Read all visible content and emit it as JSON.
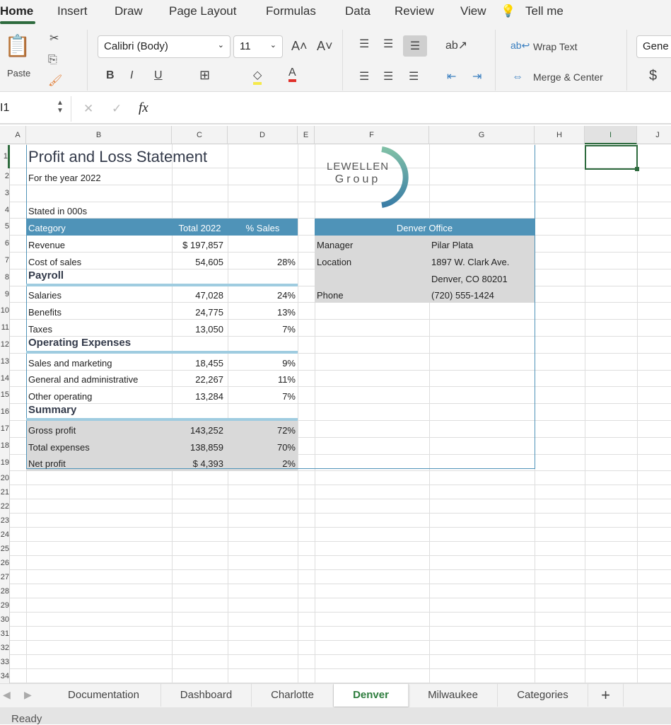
{
  "ribbon_tabs": [
    "Home",
    "Insert",
    "Draw",
    "Page Layout",
    "Formulas",
    "Data",
    "Review",
    "View",
    "Tell me"
  ],
  "ribbon": {
    "paste": "Paste",
    "font": "Calibri (Body)",
    "size": "11",
    "wrap": "Wrap Text",
    "merge": "Merge & Center",
    "number_format": "Gene",
    "bold": "B",
    "italic": "I",
    "underline": "U",
    "dollar": "$"
  },
  "formula_bar": {
    "name_box": "I1",
    "fx": "fx",
    "value": ""
  },
  "columns": [
    "A",
    "B",
    "C",
    "D",
    "E",
    "F",
    "G",
    "H",
    "I",
    "J"
  ],
  "rows": [
    "1",
    "2",
    "3",
    "4",
    "5",
    "6",
    "7",
    "8",
    "9",
    "10",
    "11",
    "12",
    "13",
    "14",
    "15",
    "16",
    "17",
    "18",
    "19",
    "20",
    "21",
    "22",
    "23",
    "24",
    "25",
    "26",
    "27",
    "28",
    "29",
    "30",
    "31",
    "32",
    "33",
    "34"
  ],
  "sheet": {
    "title": "Profit and Loss Statement",
    "subtitle": "For the year 2022",
    "stated": "Stated in 000s",
    "headers": [
      "Category",
      "Total 2022",
      "% Sales"
    ],
    "lines": [
      {
        "row": 6,
        "label": "Revenue",
        "total": "$ 197,857",
        "pct": ""
      },
      {
        "row": 7,
        "label": "Cost of sales",
        "total": "54,605",
        "pct": "28%"
      },
      {
        "row": 9,
        "label": "Salaries",
        "total": "47,028",
        "pct": "24%"
      },
      {
        "row": 10,
        "label": "Benefits",
        "total": "24,775",
        "pct": "13%"
      },
      {
        "row": 11,
        "label": "Taxes",
        "total": "13,050",
        "pct": "7%"
      },
      {
        "row": 13,
        "label": "Sales and marketing",
        "total": "18,455",
        "pct": "9%"
      },
      {
        "row": 14,
        "label": "General and administrative",
        "total": "22,267",
        "pct": "11%"
      },
      {
        "row": 15,
        "label": "Other operating",
        "total": "13,284",
        "pct": "7%"
      },
      {
        "row": 17,
        "label": "Gross profit",
        "total": "143,252",
        "pct": "72%"
      },
      {
        "row": 18,
        "label": "Total expenses",
        "total": "138,859",
        "pct": "70%"
      },
      {
        "row": 19,
        "label": "Net profit",
        "total": "$      4,393",
        "pct": "2%"
      }
    ],
    "sections": [
      {
        "row": 8,
        "label": "Payroll"
      },
      {
        "row": 12,
        "label": "Operating Expenses"
      },
      {
        "row": 16,
        "label": "Summary"
      }
    ],
    "logo": {
      "line1": "LEWELLEN",
      "line2": "Group"
    },
    "office": {
      "title": "Denver Office",
      "manager_label": "Manager",
      "manager": "Pilar Plata",
      "location_label": "Location",
      "address1": "1897 W. Clark Ave.",
      "address2": "Denver, CO 80201",
      "phone_label": "Phone",
      "phone": "(720) 555-1424"
    }
  },
  "sheet_tabs": [
    "Documentation",
    "Dashboard",
    "Charlotte",
    "Denver",
    "Milwaukee",
    "Categories"
  ],
  "active_sheet": "Denver",
  "add_sheet": "+",
  "status": "Ready",
  "colors": {
    "header": "#4f93b8",
    "accent": "#2e7d3e",
    "summary": "#d9d9d9"
  }
}
